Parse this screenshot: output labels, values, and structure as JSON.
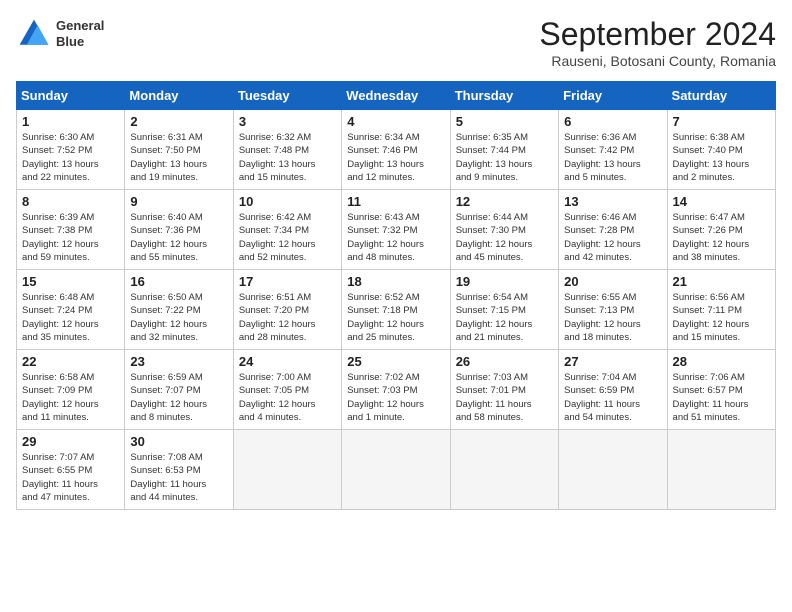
{
  "header": {
    "logo_line1": "General",
    "logo_line2": "Blue",
    "month_title": "September 2024",
    "subtitle": "Rauseni, Botosani County, Romania"
  },
  "weekdays": [
    "Sunday",
    "Monday",
    "Tuesday",
    "Wednesday",
    "Thursday",
    "Friday",
    "Saturday"
  ],
  "weeks": [
    [
      {
        "day": "1",
        "info": "Sunrise: 6:30 AM\nSunset: 7:52 PM\nDaylight: 13 hours\nand 22 minutes."
      },
      {
        "day": "2",
        "info": "Sunrise: 6:31 AM\nSunset: 7:50 PM\nDaylight: 13 hours\nand 19 minutes."
      },
      {
        "day": "3",
        "info": "Sunrise: 6:32 AM\nSunset: 7:48 PM\nDaylight: 13 hours\nand 15 minutes."
      },
      {
        "day": "4",
        "info": "Sunrise: 6:34 AM\nSunset: 7:46 PM\nDaylight: 13 hours\nand 12 minutes."
      },
      {
        "day": "5",
        "info": "Sunrise: 6:35 AM\nSunset: 7:44 PM\nDaylight: 13 hours\nand 9 minutes."
      },
      {
        "day": "6",
        "info": "Sunrise: 6:36 AM\nSunset: 7:42 PM\nDaylight: 13 hours\nand 5 minutes."
      },
      {
        "day": "7",
        "info": "Sunrise: 6:38 AM\nSunset: 7:40 PM\nDaylight: 13 hours\nand 2 minutes."
      }
    ],
    [
      {
        "day": "8",
        "info": "Sunrise: 6:39 AM\nSunset: 7:38 PM\nDaylight: 12 hours\nand 59 minutes."
      },
      {
        "day": "9",
        "info": "Sunrise: 6:40 AM\nSunset: 7:36 PM\nDaylight: 12 hours\nand 55 minutes."
      },
      {
        "day": "10",
        "info": "Sunrise: 6:42 AM\nSunset: 7:34 PM\nDaylight: 12 hours\nand 52 minutes."
      },
      {
        "day": "11",
        "info": "Sunrise: 6:43 AM\nSunset: 7:32 PM\nDaylight: 12 hours\nand 48 minutes."
      },
      {
        "day": "12",
        "info": "Sunrise: 6:44 AM\nSunset: 7:30 PM\nDaylight: 12 hours\nand 45 minutes."
      },
      {
        "day": "13",
        "info": "Sunrise: 6:46 AM\nSunset: 7:28 PM\nDaylight: 12 hours\nand 42 minutes."
      },
      {
        "day": "14",
        "info": "Sunrise: 6:47 AM\nSunset: 7:26 PM\nDaylight: 12 hours\nand 38 minutes."
      }
    ],
    [
      {
        "day": "15",
        "info": "Sunrise: 6:48 AM\nSunset: 7:24 PM\nDaylight: 12 hours\nand 35 minutes."
      },
      {
        "day": "16",
        "info": "Sunrise: 6:50 AM\nSunset: 7:22 PM\nDaylight: 12 hours\nand 32 minutes."
      },
      {
        "day": "17",
        "info": "Sunrise: 6:51 AM\nSunset: 7:20 PM\nDaylight: 12 hours\nand 28 minutes."
      },
      {
        "day": "18",
        "info": "Sunrise: 6:52 AM\nSunset: 7:18 PM\nDaylight: 12 hours\nand 25 minutes."
      },
      {
        "day": "19",
        "info": "Sunrise: 6:54 AM\nSunset: 7:15 PM\nDaylight: 12 hours\nand 21 minutes."
      },
      {
        "day": "20",
        "info": "Sunrise: 6:55 AM\nSunset: 7:13 PM\nDaylight: 12 hours\nand 18 minutes."
      },
      {
        "day": "21",
        "info": "Sunrise: 6:56 AM\nSunset: 7:11 PM\nDaylight: 12 hours\nand 15 minutes."
      }
    ],
    [
      {
        "day": "22",
        "info": "Sunrise: 6:58 AM\nSunset: 7:09 PM\nDaylight: 12 hours\nand 11 minutes."
      },
      {
        "day": "23",
        "info": "Sunrise: 6:59 AM\nSunset: 7:07 PM\nDaylight: 12 hours\nand 8 minutes."
      },
      {
        "day": "24",
        "info": "Sunrise: 7:00 AM\nSunset: 7:05 PM\nDaylight: 12 hours\nand 4 minutes."
      },
      {
        "day": "25",
        "info": "Sunrise: 7:02 AM\nSunset: 7:03 PM\nDaylight: 12 hours\nand 1 minute."
      },
      {
        "day": "26",
        "info": "Sunrise: 7:03 AM\nSunset: 7:01 PM\nDaylight: 11 hours\nand 58 minutes."
      },
      {
        "day": "27",
        "info": "Sunrise: 7:04 AM\nSunset: 6:59 PM\nDaylight: 11 hours\nand 54 minutes."
      },
      {
        "day": "28",
        "info": "Sunrise: 7:06 AM\nSunset: 6:57 PM\nDaylight: 11 hours\nand 51 minutes."
      }
    ],
    [
      {
        "day": "29",
        "info": "Sunrise: 7:07 AM\nSunset: 6:55 PM\nDaylight: 11 hours\nand 47 minutes."
      },
      {
        "day": "30",
        "info": "Sunrise: 7:08 AM\nSunset: 6:53 PM\nDaylight: 11 hours\nand 44 minutes."
      },
      {
        "day": "",
        "info": ""
      },
      {
        "day": "",
        "info": ""
      },
      {
        "day": "",
        "info": ""
      },
      {
        "day": "",
        "info": ""
      },
      {
        "day": "",
        "info": ""
      }
    ]
  ]
}
